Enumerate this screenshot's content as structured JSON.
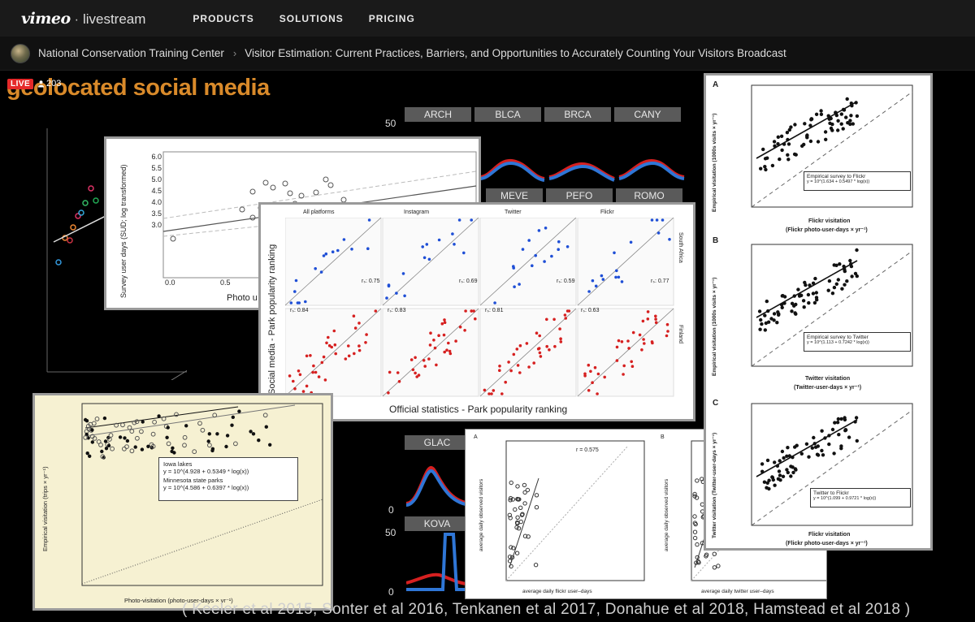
{
  "nav": {
    "logo_brand": "vimeo",
    "logo_separator": "·",
    "logo_product": "livestream",
    "items": [
      "PRODUCTS",
      "SOLUTIONS",
      "PRICING"
    ]
  },
  "breadcrumb": {
    "org": "National Conservation Training Center",
    "separator_icon": "chevron-right-icon",
    "event": "Visitor Estimation: Current Practices, Barriers, and Opportunities to Accurately Counting Your Visitors Broadcast"
  },
  "video": {
    "live_label": "LIVE",
    "viewer_count": "203",
    "slide_title": "geolocated social media",
    "citation": "( Keeler et al 2015, Sonter et al 2016, Tenkanen et al 2017, Donahue et al 2018, Hamstead et al 2018 )",
    "park_codes_top": [
      "ARCH",
      "BLCA",
      "BRCA",
      "CANY"
    ],
    "park_codes_mid": [
      "MEVE",
      "PEFO",
      "ROMO"
    ],
    "park_codes_low": [
      "GLAC",
      "KOVA"
    ],
    "center_axis": [
      "50",
      "0",
      "50",
      "0"
    ],
    "panel_survey": {
      "ylabel": "Survey user days (SUD; log transformed)",
      "xlabel": "Photo u",
      "yticks": [
        "6.0",
        "5.5",
        "5.0",
        "4.5",
        "4.0",
        "3.5",
        "3.0"
      ],
      "xticks": [
        "0.0",
        "0.5"
      ]
    },
    "panel_ranking": {
      "columns": [
        "All platforms",
        "Instagram",
        "Twitter",
        "Flickr"
      ],
      "row_labels": [
        "South Africa",
        "Finland"
      ],
      "rs_top": [
        "rₛ: 0.75",
        "rₛ: 0.69",
        "rₛ: 0.59",
        "rₛ: 0.77"
      ],
      "rs_bottom": [
        "rₛ: 0.84",
        "rₛ: 0.83",
        "rₛ: 0.81",
        "rₛ: 0.63"
      ],
      "ylabel": "Social media - Park popularity ranking",
      "xlabel": "Official statistics - Park popularity ranking"
    },
    "panel_lakes": {
      "ylabel": "Empirical visitation (trips × yr⁻¹)",
      "xlabel": "Photo-visitation (photo-user-days × yr⁻¹)",
      "legend": [
        {
          "name": "Iowa lakes",
          "eq": "y = 10^(4.928 + 0.5349 * log(x))"
        },
        {
          "name": "Minnesota state parks",
          "eq": "y = 10^(4.586 + 0.6397 * log(x))"
        }
      ]
    },
    "panel_daily": {
      "label_a": "A",
      "label_b": "B",
      "r_a": "r = 0.575",
      "ylabel": "average daily observed visitors",
      "xlabel_a": "average daily flickr user–days",
      "xlabel_b": "average daily twitter user–days"
    },
    "panel_abc": {
      "A": {
        "label": "A",
        "ylabel": "Empirical visitation (1000s visits × yr⁻¹)",
        "xlabel1": "Flickr visitation",
        "xlabel2": "(Flickr photo-user-days × yr⁻¹)",
        "legend": "Empirical survey to Flickr",
        "eq": "y = 10^(1.634 + 0.5497 * log(x))"
      },
      "B": {
        "label": "B",
        "ylabel": "Empirical visitation (1000s visits × yr⁻¹)",
        "xlabel1": "Twitter visitation",
        "xlabel2": "(Twitter-user-days × yr⁻¹)",
        "legend": "Empirical survey to Twitter",
        "eq": "y = 10^(1.113 + 0.7242 * log(x))"
      },
      "C": {
        "label": "C",
        "ylabel": "Twitter visitation (Twitter-user-days × yr⁻¹)",
        "xlabel1": "Flickr visitation",
        "xlabel2": "(Flickr photo-user-days × yr⁻¹)",
        "legend": "Twitter to Flickr",
        "eq": "y = 10^(1.099 + 0.9721 * log(x))"
      }
    }
  },
  "colors": {
    "nav_bg": "#1a1a1a",
    "live_red": "#e5292a",
    "title_orange": "#d98a2a",
    "series_blue": "#1f4fd6",
    "series_red": "#d62020"
  }
}
